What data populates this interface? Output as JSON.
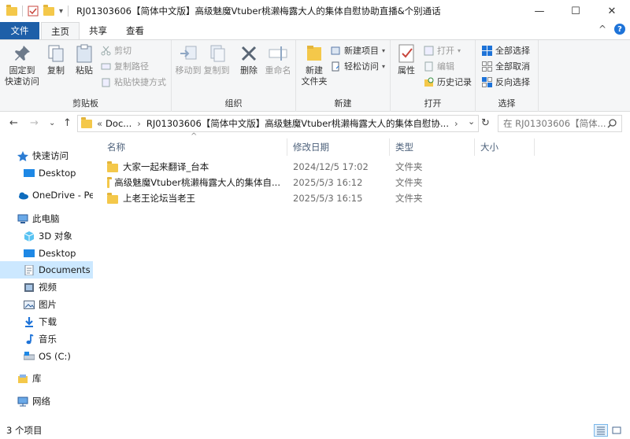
{
  "window": {
    "title": "RJ01303606【简体中文版】高级魅魔Vtuber桃濑梅露大人的集体自慰协助直播&个别通话",
    "controls": {
      "minimize": "—",
      "maximize": "☐",
      "close": "✕"
    },
    "quick_access_dropdown": "▾"
  },
  "ribbon_tabs": {
    "file": "文件",
    "home": "主页",
    "share": "共享",
    "view": "查看",
    "collapse_chevron": "^",
    "help": "?"
  },
  "ribbon": {
    "clipboard": {
      "label": "剪贴板",
      "pin": "固定到\n快速访问",
      "copy": "复制",
      "paste": "粘贴",
      "cut": "剪切",
      "copy_path": "复制路径",
      "paste_shortcut": "粘贴快捷方式"
    },
    "organize": {
      "label": "组织",
      "move_to": "移动到",
      "copy_to": "复制到",
      "delete": "删除",
      "rename": "重命名"
    },
    "new": {
      "label": "新建",
      "new_folder": "新建\n文件夹",
      "new_item": "新建项目",
      "easy_access": "轻松访问"
    },
    "open": {
      "label": "打开",
      "properties": "属性",
      "open": "打开",
      "edit": "编辑",
      "history": "历史记录"
    },
    "select": {
      "label": "选择",
      "select_all": "全部选择",
      "select_none": "全部取消",
      "invert": "反向选择"
    }
  },
  "address": {
    "back": "←",
    "forward": "→",
    "dropdown": "⌄",
    "up": "↑",
    "overflow": "«",
    "parts": [
      "Doc...",
      "RJ01303606【简体中文版】高级魅魔Vtuber桃濑梅露大人的集体自慰协..."
    ],
    "sep": "›",
    "refresh": "↻",
    "search_placeholder": "在 RJ01303606【简体..."
  },
  "nav": [
    {
      "label": "快速访问",
      "icon": "star-icon"
    },
    {
      "label": "Desktop",
      "icon": "desktop-icon"
    },
    {
      "label": "OneDrive - Per",
      "icon": "cloud-icon"
    },
    {
      "label": "此电脑",
      "icon": "computer-icon"
    },
    {
      "label": "3D 对象",
      "icon": "cube-icon"
    },
    {
      "label": "Desktop",
      "icon": "desktop-icon"
    },
    {
      "label": "Documents",
      "icon": "document-icon"
    },
    {
      "label": "视频",
      "icon": "video-icon"
    },
    {
      "label": "图片",
      "icon": "picture-icon"
    },
    {
      "label": "下载",
      "icon": "download-icon"
    },
    {
      "label": "音乐",
      "icon": "music-icon"
    },
    {
      "label": "OS (C:)",
      "icon": "drive-icon"
    },
    {
      "label": "库",
      "icon": "library-icon"
    },
    {
      "label": "网络",
      "icon": "network-icon"
    }
  ],
  "columns": {
    "name": "名称",
    "date": "修改日期",
    "type": "类型",
    "size": "大小",
    "sort_arrow": "^"
  },
  "files": [
    {
      "name": "大家一起来翻译_台本",
      "date": "2024/12/5 17:02",
      "type": "文件夹"
    },
    {
      "name": "高级魅魔Vtuber桃濑梅露大人的集体自...",
      "date": "2025/5/3 16:12",
      "type": "文件夹"
    },
    {
      "name": "上老王论坛当老王",
      "date": "2025/5/3 16:15",
      "type": "文件夹"
    }
  ],
  "status": {
    "item_count": "3 个项目"
  },
  "colors": {
    "accent": "#1e5fa8",
    "selection": "#cce8ff",
    "folder": "#f4c84a"
  }
}
